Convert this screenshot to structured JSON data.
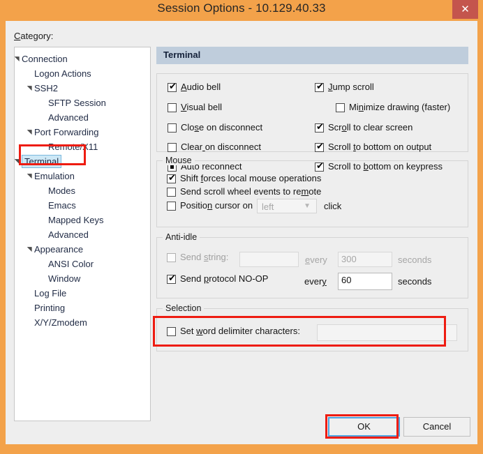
{
  "window": {
    "title": "Session Options - 10.129.40.33",
    "close_label": "✕",
    "titlebar_color": "#f3a24a",
    "close_button_color": "#c4554d",
    "annotation_color": "#ee1c11"
  },
  "category": {
    "label_prefix": "",
    "label_acc": "C",
    "label_rest": "ategory:",
    "tree": [
      {
        "label": "Connection",
        "indent": 0,
        "arrow": "expanded",
        "selected": false
      },
      {
        "label": "Logon Actions",
        "indent": 1,
        "arrow": "none",
        "selected": false
      },
      {
        "label": "SSH2",
        "indent": 1,
        "arrow": "expanded",
        "selected": false
      },
      {
        "label": "SFTP Session",
        "indent": 2,
        "arrow": "none",
        "selected": false
      },
      {
        "label": "Advanced",
        "indent": 2,
        "arrow": "none",
        "selected": false
      },
      {
        "label": "Port Forwarding",
        "indent": 1,
        "arrow": "expanded",
        "selected": false
      },
      {
        "label": "Remote/X11",
        "indent": 2,
        "arrow": "none",
        "selected": false
      },
      {
        "label": "Terminal",
        "indent": 0,
        "arrow": "expanded",
        "selected": true
      },
      {
        "label": "Emulation",
        "indent": 1,
        "arrow": "expanded",
        "selected": false
      },
      {
        "label": "Modes",
        "indent": 2,
        "arrow": "none",
        "selected": false
      },
      {
        "label": "Emacs",
        "indent": 2,
        "arrow": "none",
        "selected": false
      },
      {
        "label": "Mapped Keys",
        "indent": 2,
        "arrow": "none",
        "selected": false
      },
      {
        "label": "Advanced",
        "indent": 2,
        "arrow": "none",
        "selected": false
      },
      {
        "label": "Appearance",
        "indent": 1,
        "arrow": "expanded",
        "selected": false
      },
      {
        "label": "ANSI Color",
        "indent": 2,
        "arrow": "none",
        "selected": false
      },
      {
        "label": "Window",
        "indent": 2,
        "arrow": "none",
        "selected": false
      },
      {
        "label": "Log File",
        "indent": 1,
        "arrow": "none",
        "selected": false
      },
      {
        "label": "Printing",
        "indent": 1,
        "arrow": "none",
        "selected": false
      },
      {
        "label": "X/Y/Zmodem",
        "indent": 1,
        "arrow": "none",
        "selected": false
      }
    ]
  },
  "panel": {
    "header": "Terminal",
    "general": {
      "left_column": [
        {
          "label_pre": "",
          "label_acc": "A",
          "label_post": "udio bell",
          "state": "checked"
        },
        {
          "label_pre": "",
          "label_acc": "V",
          "label_post": "isual bell",
          "state": "unchecked"
        },
        {
          "label_pre": "Clo",
          "label_acc": "s",
          "label_post": "e on disconnect",
          "state": "unchecked"
        },
        {
          "label_pre": "Clear",
          "label_acc": " ",
          "label_post": "on disconnect",
          "state": "unchecked"
        },
        {
          "label_pre": "Auto reconnect",
          "label_acc": "",
          "label_post": "",
          "state": "indeterminate"
        }
      ],
      "right_column": [
        {
          "label_pre": "",
          "label_acc": "J",
          "label_post": "ump scroll",
          "state": "checked",
          "offset": 0
        },
        {
          "label_pre": "Mi",
          "label_acc": "n",
          "label_post": "imize drawing (faster)",
          "state": "unchecked",
          "offset": 30
        },
        {
          "label_pre": "Scr",
          "label_acc": "o",
          "label_post": "ll to clear screen",
          "state": "checked",
          "offset": 0
        },
        {
          "label_pre": "Scroll ",
          "label_acc": "t",
          "label_post": "o bottom on output",
          "state": "checked",
          "offset": 0
        },
        {
          "label_pre": "Scroll to ",
          "label_acc": "b",
          "label_post": "ottom on keypress",
          "state": "checked",
          "offset": 0
        }
      ]
    },
    "mouse": {
      "legend": "Mouse",
      "items": [
        {
          "label_pre": "Shift ",
          "label_acc": "f",
          "label_post": "orces local mouse operations",
          "state": "checked"
        },
        {
          "label_pre": "Send scroll wheel events to re",
          "label_acc": "m",
          "label_post": "ote",
          "state": "unchecked"
        },
        {
          "label_pre": "Positio",
          "label_acc": "n",
          "label_post": " cursor on",
          "state": "unchecked"
        }
      ],
      "position_dropdown_value": "left",
      "position_suffix": "click"
    },
    "antiidle": {
      "legend": "Anti-idle",
      "send_string": {
        "label_pre": "Send ",
        "label_acc": "s",
        "label_post": "tring:",
        "state": "unchecked",
        "disabled": true
      },
      "send_string_value": "",
      "send_string_every_pre": "",
      "send_string_every_acc": "e",
      "send_string_every_post": "very",
      "send_string_interval": "300",
      "send_string_seconds": "seconds",
      "noop": {
        "label_pre": "Send ",
        "label_acc": "p",
        "label_post": "rotocol NO-OP",
        "state": "checked",
        "disabled": false
      },
      "noop_every_pre": "ever",
      "noop_every_acc": "y",
      "noop_every_post": "",
      "noop_interval": "60",
      "noop_seconds": "seconds"
    },
    "selection": {
      "legend": "Selection",
      "checkbox": {
        "label_pre": "Set ",
        "label_acc": "w",
        "label_post": "ord delimiter characters:",
        "state": "unchecked"
      },
      "value": ""
    }
  },
  "footer": {
    "ok_label": "OK",
    "cancel_label": "Cancel"
  }
}
